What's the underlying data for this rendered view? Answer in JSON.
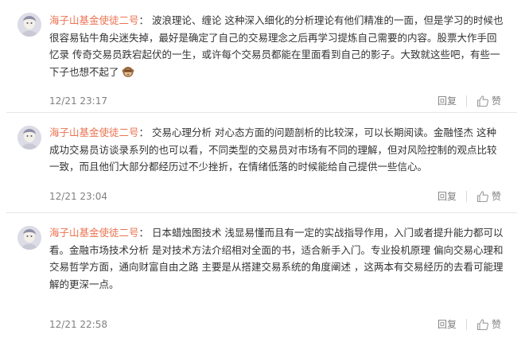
{
  "comments": [
    {
      "user": "海子山基金使徒二号",
      "colon": "：",
      "text": "波浪理论、缠论 这种深入细化的分析理论有他们精准的一面，但是学习的时候也很容易钻牛角尖迷失掉，最好是确定了自己的交易理念之后再学习提炼自己需要的内容。股票大作手回忆录 传奇交易员跌宕起伏的一生，或许每个交易员都能在里面看到自己的影子。大致就这些吧，有些一下子也想不起了",
      "emoji": "see-no-evil-monkey",
      "time": "12/21 23:17",
      "reply": "回复",
      "like": "赞"
    },
    {
      "user": "海子山基金使徒二号",
      "colon": "：",
      "text": "交易心理分析 对心态方面的问题剖析的比较深，可以长期阅读。金融怪杰 这种成功交易员访谈录系列的也可以看，不同类型的交易员对市场有不同的理解，但对风险控制的观点比较一致，而且他们大部分都经历过不少挫折，在情绪低落的时候能给自己提供一些信心。",
      "time": "12/21 23:04",
      "reply": "回复",
      "like": "赞"
    },
    {
      "user": "海子山基金使徒二号",
      "colon": "：",
      "text": "日本蜡烛图技术 浅显易懂而且有一定的实战指导作用，入门或者提升能力都可以看。金融市场技术分析 是对技术方法介绍相对全面的书，适合新手入门。专业投机原理 偏向交易心理和交易哲学方面，通向财富自由之路 主要是从搭建交易系统的角度阐述 ，这两本有交易经历的去看可能理解的更深一点。",
      "time": "12/21 22:58",
      "reply": "回复",
      "like": "赞"
    }
  ],
  "icons": {
    "avatar": "user-avatar-icon",
    "like": "thumbs-up-icon"
  },
  "colors": {
    "username": "#eb7350",
    "meta": "#808080",
    "divider": "#e6e6e6"
  }
}
